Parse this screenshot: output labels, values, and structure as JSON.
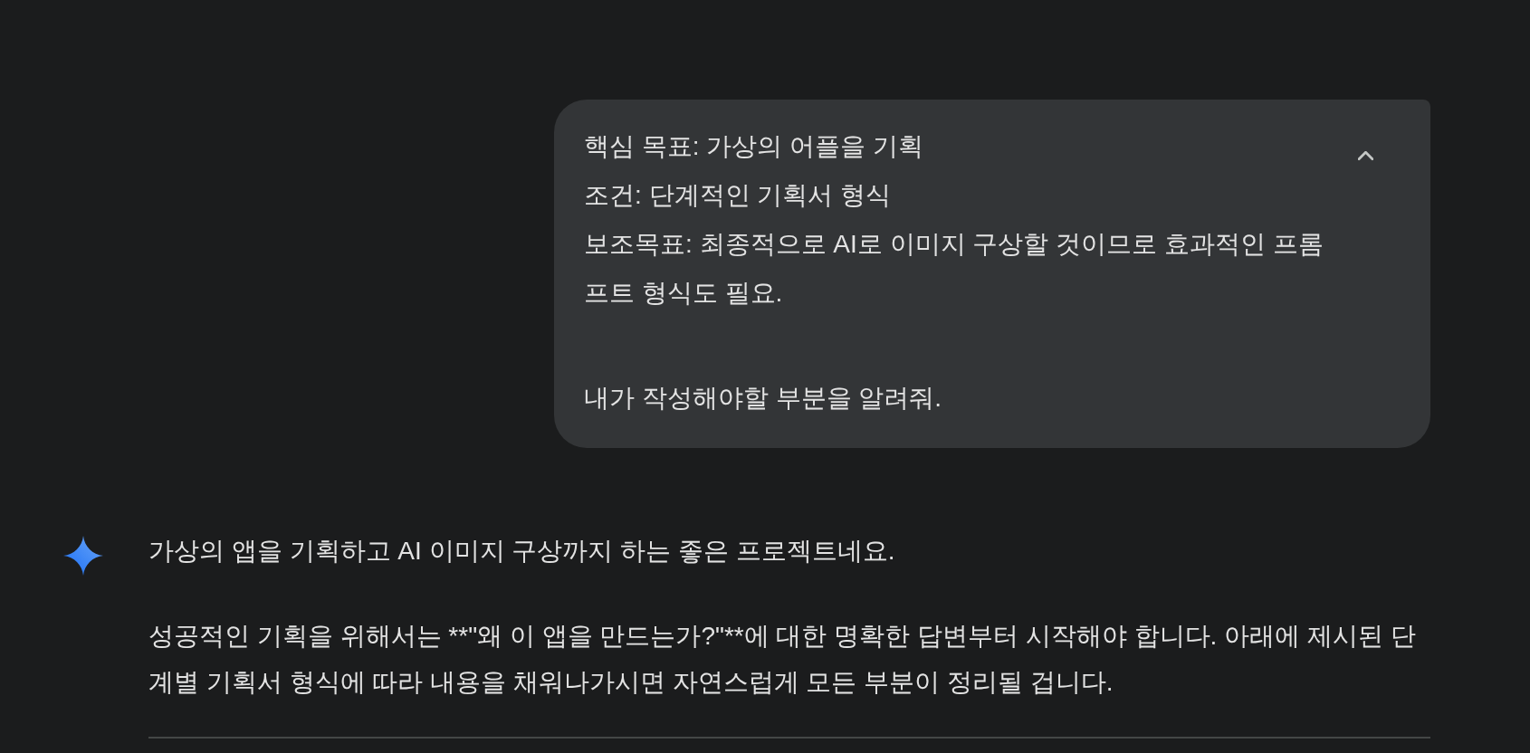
{
  "user_message": {
    "expanded": true,
    "paragraphs": [
      {
        "lines": [
          "핵심 목표: 가상의 어플을 기획",
          "조건: 단계적인 기획서 형식",
          "보조목표: 최종적으로 AI로 이미지 구상할 것이므로 효과적인 프롬",
          "프트 형식도 필요."
        ]
      },
      {
        "lines": [
          "내가 작성해야할 부분을 알려줘."
        ]
      }
    ]
  },
  "response": {
    "paragraphs": [
      {
        "lines": [
          "가상의 앱을 기획하고 AI 이미지 구상까지 하는 좋은 프로젝트네요."
        ]
      },
      {
        "lines": [
          "성공적인 기획을 위해서는 **\"왜 이 앱을 만드는가?\"**에 대한 명확한 답변부터 시작해야 합니다. 아래에 제시된 단",
          "계별 기획서 형식에 따라 내용을 채워나가시면 자연스럽게 모든 부분이 정리될 겁니다."
        ]
      }
    ]
  }
}
